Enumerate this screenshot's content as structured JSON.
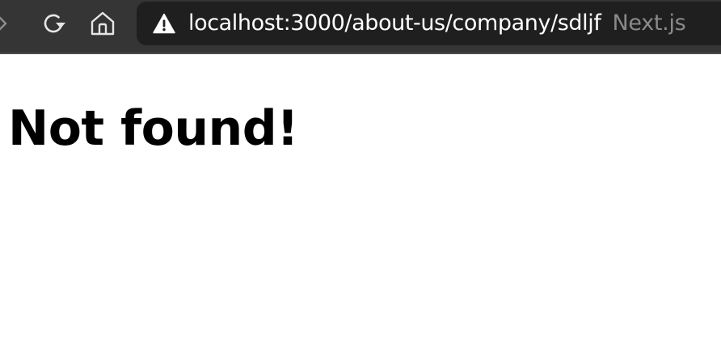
{
  "browser": {
    "address_bar": {
      "url": "localhost:3000/about-us/company/sdljf",
      "page_title": "Next.js"
    },
    "icons": {
      "forward": "chevron-right-icon",
      "reload": "reload-icon",
      "home": "home-icon",
      "security": "warning-icon"
    },
    "colors": {
      "toolbar": "#353535",
      "address_bar": "#1f1f1f",
      "url_text": "#ffffff",
      "page_title_text": "#8a8a8a"
    }
  },
  "page": {
    "heading": "Not found!",
    "background": "#ffffff"
  }
}
